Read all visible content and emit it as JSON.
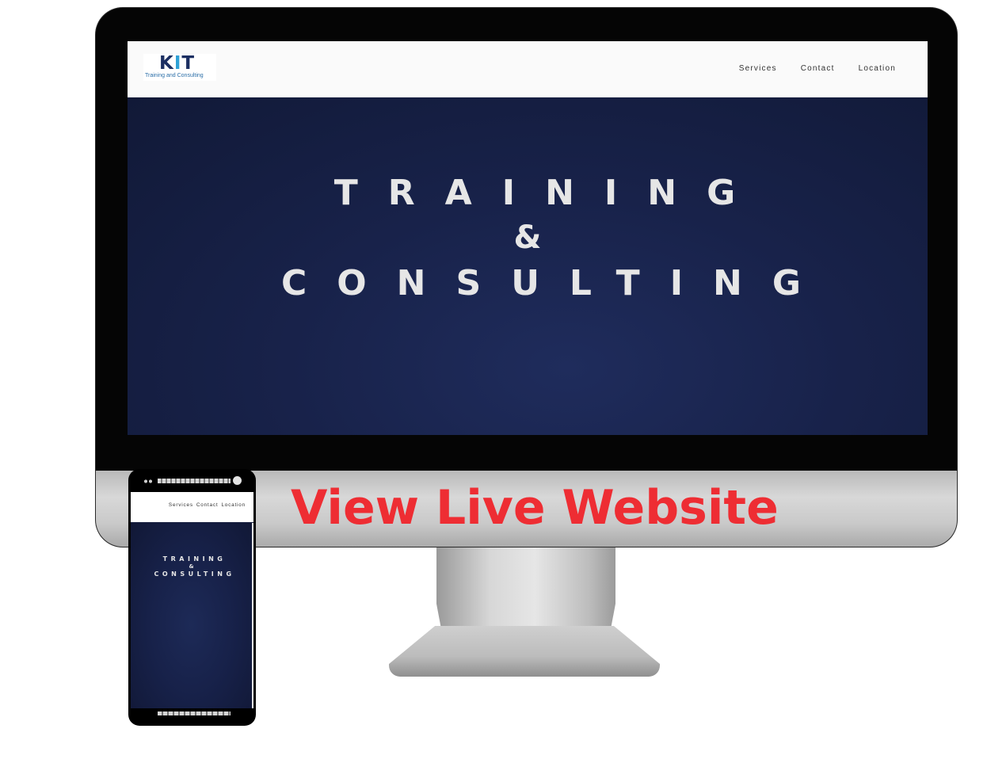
{
  "desktop": {
    "logo": {
      "mark_prefix": "K",
      "mark_accent": "I",
      "mark_suffix": "T",
      "tagline": "Training and Consulting"
    },
    "nav": [
      {
        "label": "Services"
      },
      {
        "label": "Contact"
      },
      {
        "label": "Location"
      }
    ],
    "hero": {
      "line1": "TRAINING",
      "amp": "&",
      "line2": "CONSULTING"
    }
  },
  "cta": {
    "label": "View Live Website"
  },
  "mobile": {
    "nav": [
      {
        "label": "Services"
      },
      {
        "label": "Contact"
      },
      {
        "label": "Location"
      }
    ],
    "hero": {
      "line1": "TRAINING",
      "amp": "&",
      "line2": "CONSULTING"
    }
  },
  "colors": {
    "cta": "#ee2d33",
    "hero_bg": "#18224a",
    "logo_dark": "#1c2f62",
    "logo_accent": "#2ea1d6"
  }
}
